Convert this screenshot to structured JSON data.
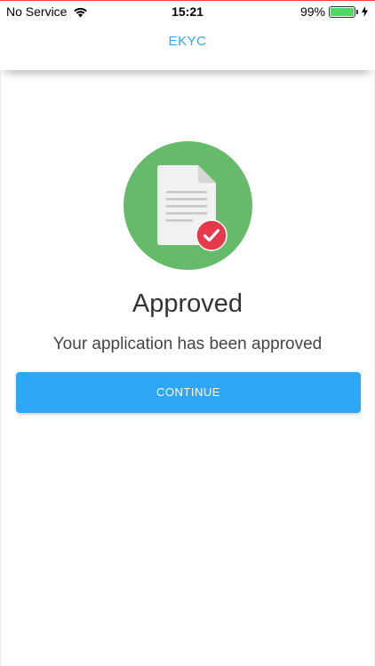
{
  "status_bar": {
    "carrier": "No Service",
    "time": "15:21",
    "battery_percent": "99%",
    "battery_level": 0.99,
    "icons": [
      "wifi-icon",
      "battery-icon",
      "charging-icon"
    ]
  },
  "header": {
    "title": "EKYC"
  },
  "main": {
    "illustration_icon": "document-approved-icon",
    "title": "Approved",
    "subtitle": "Your application has been approved",
    "continue_label": "CONTINUE"
  },
  "colors": {
    "accent": "#2ea7f6",
    "header_title": "#2fa9f2",
    "illustration_bg": "#66bb6a",
    "badge": "#e5394b"
  }
}
